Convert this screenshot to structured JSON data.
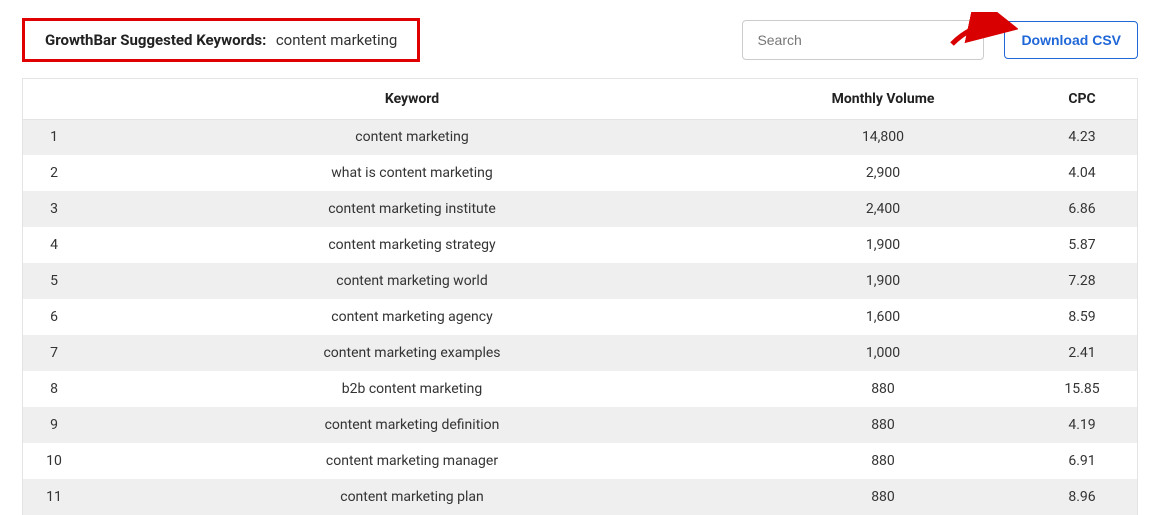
{
  "header": {
    "title_label": "GrowthBar Suggested Keywords:",
    "title_value": "content marketing"
  },
  "search": {
    "placeholder": "Search"
  },
  "download_csv_label": "Download CSV",
  "table": {
    "columns": {
      "index": "",
      "keyword": "Keyword",
      "volume": "Monthly Volume",
      "cpc": "CPC"
    },
    "rows": [
      {
        "index": "1",
        "keyword": "content marketing",
        "volume": "14,800",
        "cpc": "4.23"
      },
      {
        "index": "2",
        "keyword": "what is content marketing",
        "volume": "2,900",
        "cpc": "4.04"
      },
      {
        "index": "3",
        "keyword": "content marketing institute",
        "volume": "2,400",
        "cpc": "6.86"
      },
      {
        "index": "4",
        "keyword": "content marketing strategy",
        "volume": "1,900",
        "cpc": "5.87"
      },
      {
        "index": "5",
        "keyword": "content marketing world",
        "volume": "1,900",
        "cpc": "7.28"
      },
      {
        "index": "6",
        "keyword": "content marketing agency",
        "volume": "1,600",
        "cpc": "8.59"
      },
      {
        "index": "7",
        "keyword": "content marketing examples",
        "volume": "1,000",
        "cpc": "2.41"
      },
      {
        "index": "8",
        "keyword": "b2b content marketing",
        "volume": "880",
        "cpc": "15.85"
      },
      {
        "index": "9",
        "keyword": "content marketing definition",
        "volume": "880",
        "cpc": "4.19"
      },
      {
        "index": "10",
        "keyword": "content marketing manager",
        "volume": "880",
        "cpc": "6.91"
      },
      {
        "index": "11",
        "keyword": "content marketing plan",
        "volume": "880",
        "cpc": "8.96"
      }
    ]
  }
}
